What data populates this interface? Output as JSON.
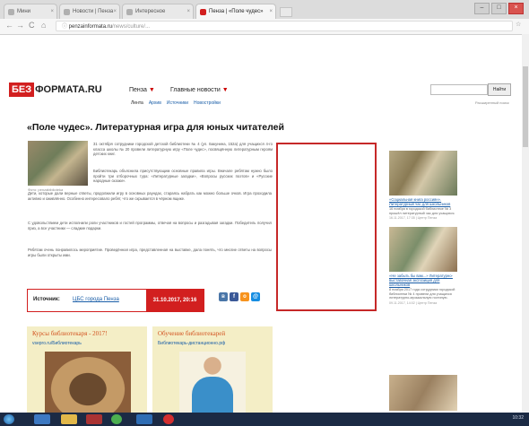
{
  "browser": {
    "tabs": [
      {
        "label": "Мини"
      },
      {
        "label": "Новости | Пенза"
      },
      {
        "label": "Интересное"
      },
      {
        "label": "Пенза | «Поле чудес»",
        "active": true
      }
    ],
    "url_host": "penzainformatа.ru",
    "url_path": "/news/culture/..."
  },
  "site": {
    "logo_red": "БЕЗ",
    "logo_text": "ФОРМАТА.RU",
    "city": "Пенза",
    "main_news": "Главные новости",
    "subnav": [
      "Лента",
      "Архив",
      "Источники",
      "Новостройки"
    ],
    "search_btn": "Найти",
    "adv_link": "Расширенный поиск"
  },
  "article": {
    "title": "«Поле чудес». Литературная игра для юных читателей",
    "photo_caption": "Фото: penzabiblioteka",
    "p1": "31 октября сотрудники городской детской библиотеки № 4 (ул. Бакунина, 152а) для учащихся 4-го класса школы № 20 провели литературную игру «Поле чудес», посвящённую литературным героям детских книг.",
    "p2": "Библиотекарь объяснила присутствующим основные правила игры. Вначале ребятам нужно было пройти три отборочных тура: «Литературные загадки», «Вопросы русских поэтов» и «Русские народные сказки».",
    "p3": "Дети, которые дали верные ответы, продолжили игру в основных раундах, стараясь набрать как можно больше очков. Игра проходила активно и оживлённо. Особенно интересовало ребят, что же скрывается в чёрном ящике.",
    "p4": "С удовольствием дети исполнили роли участников и гостей программы, отвечая на вопросы и разгадывая загадки. Победитель получил приз, а все участники — сладкие подарки.",
    "p5": "Ребятам очень понравилось мероприятие. Проведённая игра, представленная на выставке, дала понять, что многие ответы на вопросы игры были открыты ими.",
    "source_label": "Источник:",
    "source_value": "ЦБС города Пенза",
    "date": "31.10.2017, 20:16"
  },
  "sidebar": [
    {
      "caption": "«Социальная книга россиян». Литературный час для школьников",
      "text": "16 ноября в городской библиотеке № 3 прошёл литературный час для учащихся.",
      "meta": "16.11.2017, 17:35 | Центр Пенза"
    },
    {
      "caption": "«Не забыть бы вам...» Литературно-выставочная экспозиция для школьников",
      "text": "8 ноября 2017 года сотрудники городской библиотеки № 4 провели для учащихся литературно-музыкальную гостиную.",
      "meta": "09.11.2017, 14:02 | Центр Пенза"
    }
  ],
  "panels": [
    {
      "heading": "Курсы библиотекаря - 2017!",
      "link": "vsepro.ru/Библиотекарь"
    },
    {
      "heading": "Обучение библиотекарей",
      "link": "Библиотекарь-дистанционно.рф"
    }
  ],
  "taskbar": {
    "clock": "10:32"
  }
}
